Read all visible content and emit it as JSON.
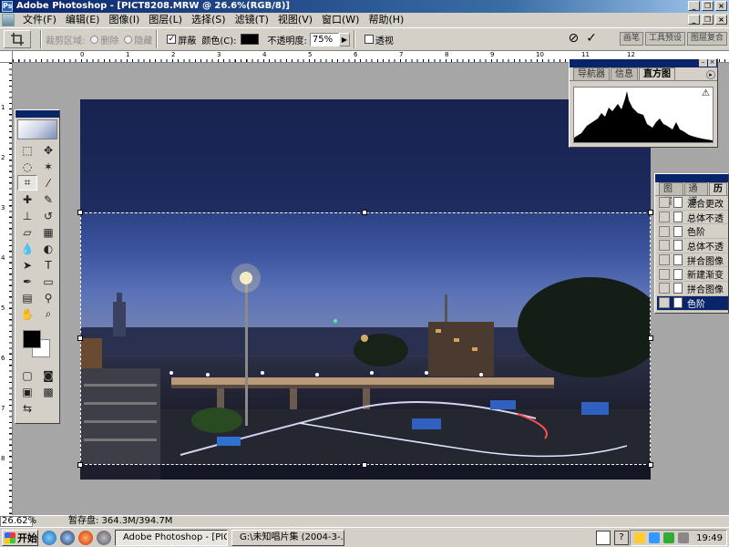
{
  "window": {
    "title": "Adobe Photoshop - [PICT8208.MRW @ 26.6%(RGB/8)]",
    "controls": [
      "_",
      "❐",
      "×"
    ]
  },
  "menu": {
    "items": [
      "文件(F)",
      "编辑(E)",
      "图像(I)",
      "图层(L)",
      "选择(S)",
      "滤镜(T)",
      "视图(V)",
      "窗口(W)",
      "帮助(H)"
    ]
  },
  "options": {
    "crop_area_label": "裁剪区域:",
    "delete_label": "删除",
    "hide_label": "隐藏",
    "shield_label": "屏蔽",
    "color_label": "颜色(C):",
    "opacity_label": "不透明度:",
    "opacity_value": "75%",
    "perspective_label": "透视",
    "shield_checked": "✓",
    "cancel_icon": "⊘",
    "commit_icon": "✓",
    "shield_color": "#000000"
  },
  "palette_well": {
    "tabs": [
      "画笔",
      "工具预设",
      "图层复合"
    ]
  },
  "navigator": {
    "tabs": [
      "导航器",
      "信息",
      "直方图"
    ],
    "active_tab": "直方图",
    "warning_icon": "⚠"
  },
  "history": {
    "tabs": [
      "图层",
      "通道",
      "历"
    ],
    "rows": [
      {
        "label": "混合更改"
      },
      {
        "label": "总体不透"
      },
      {
        "label": "色阶"
      },
      {
        "label": "总体不透"
      },
      {
        "label": "拼合图像"
      },
      {
        "label": "新建渐变"
      },
      {
        "label": "拼合图像"
      },
      {
        "label": "色阶",
        "selected": true
      }
    ]
  },
  "ruler": {
    "h_labels": [
      "0",
      "1",
      "2",
      "3",
      "4",
      "5",
      "6",
      "7",
      "8",
      "9",
      "10",
      "11",
      "12"
    ],
    "v_labels": [
      "1",
      "2",
      "3",
      "4",
      "5",
      "6",
      "7",
      "8"
    ]
  },
  "status": {
    "zoom": "26.62%",
    "scratch": "暂存盘: 364.3M/394.7M"
  },
  "taskbar": {
    "start_label": "开始",
    "tasks": [
      {
        "label": "Adobe Photoshop - [PIC...",
        "active": true
      },
      {
        "label": "G:\\未知唱片集 (2004-3-...",
        "active": false
      }
    ],
    "clock": "19:49",
    "help_icon": "?"
  },
  "colors": {
    "title_bar": "#0a246a",
    "foreground": "#000000",
    "background": "#ffffff"
  }
}
